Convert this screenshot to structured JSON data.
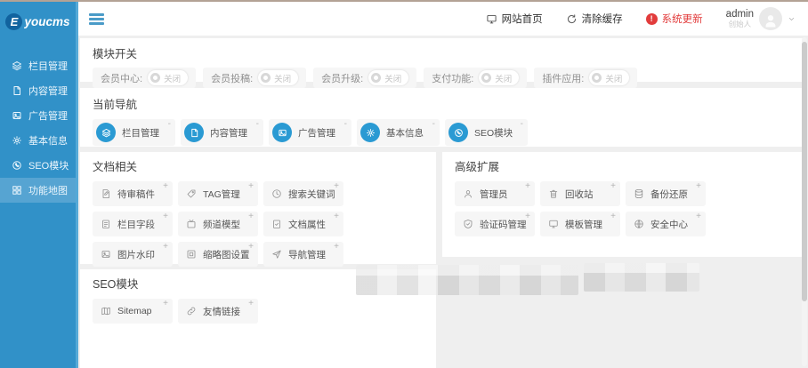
{
  "sidebar": {
    "logo": {
      "letter": "E",
      "text": "youcms"
    },
    "items": [
      {
        "label": "栏目管理"
      },
      {
        "label": "内容管理"
      },
      {
        "label": "广告管理"
      },
      {
        "label": "基本信息"
      },
      {
        "label": "SEO模块"
      },
      {
        "label": "功能地图",
        "active": true
      }
    ]
  },
  "topbar": {
    "site_home": "网站首页",
    "clear_cache": "清除缓存",
    "system_update": "系统更新",
    "update_badge": "!",
    "user": {
      "name": "admin",
      "role": "创始人"
    }
  },
  "symbols": {
    "add": "+",
    "remove": "-"
  },
  "sections": {
    "module_switch": {
      "title": "模块开关",
      "switches": [
        {
          "label": "会员中心:",
          "state": "关闭"
        },
        {
          "label": "会员投稿:",
          "state": "关闭"
        },
        {
          "label": "会员升级:",
          "state": "关闭"
        },
        {
          "label": "支付功能:",
          "state": "关闭"
        },
        {
          "label": "插件应用:",
          "state": "关闭"
        }
      ]
    },
    "current_nav": {
      "title": "当前导航",
      "items": [
        {
          "label": "栏目管理"
        },
        {
          "label": "内容管理"
        },
        {
          "label": "广告管理"
        },
        {
          "label": "基本信息"
        },
        {
          "label": "SEO模块"
        }
      ]
    },
    "document": {
      "title": "文档相关",
      "items": [
        {
          "label": "待审稿件"
        },
        {
          "label": "TAG管理"
        },
        {
          "label": "搜索关键词"
        },
        {
          "label": "栏目字段"
        },
        {
          "label": "频道模型"
        },
        {
          "label": "文档属性"
        },
        {
          "label": "图片水印"
        },
        {
          "label": "缩略图设置"
        },
        {
          "label": "导航管理"
        }
      ]
    },
    "advanced": {
      "title": "高级扩展",
      "items": [
        {
          "label": "管理员"
        },
        {
          "label": "回收站"
        },
        {
          "label": "备份还原"
        },
        {
          "label": "验证码管理"
        },
        {
          "label": "模板管理"
        },
        {
          "label": "安全中心"
        }
      ]
    },
    "seo": {
      "title": "SEO模块",
      "items": [
        {
          "label": "Sitemap"
        },
        {
          "label": "友情链接"
        }
      ]
    }
  },
  "colors": {
    "sidebar_blue": "#3191c8",
    "icon_blue": "#2a9ad3",
    "alert_red": "#e23c3c",
    "page_bg": "#efefef",
    "panel_bg": "#ffffff"
  }
}
